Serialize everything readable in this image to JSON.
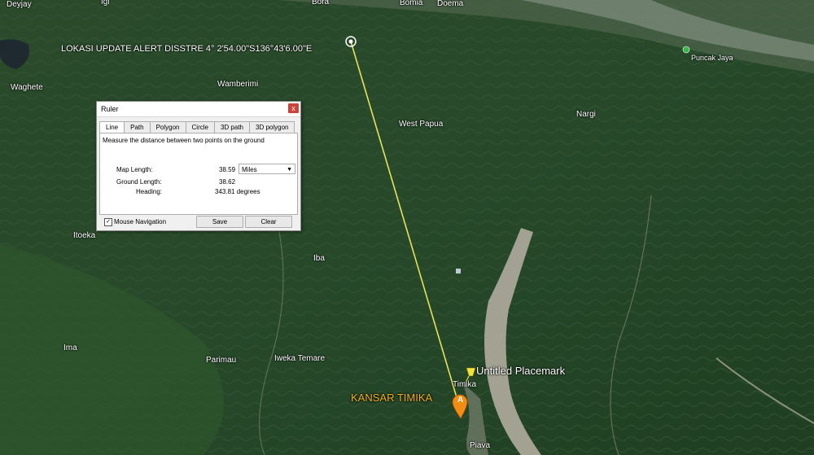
{
  "map": {
    "alert_text": "LOKASI UPDATE ALERT DISSTRE   4° 2'54.00\"S136°43'6.00\"E",
    "places": {
      "deyjay": "Deyjay",
      "bgi": "Igi",
      "bora": "Bora",
      "bomia": "Bomia",
      "doema": "Doema",
      "waghete": "Waghete",
      "wamberimi": "Wamberimi",
      "west_papua": "West Papua",
      "nargi": "Nargi",
      "puncak_jaya": "Puncak Jaya",
      "itoeka": "Itoeka",
      "iba": "Iba",
      "ima": "Ima",
      "parimau": "Parimau",
      "iweka_temare": "Iweka Temare",
      "timika": "Timika",
      "piava": "Piava"
    },
    "placemark_label": "Untitled Placemark",
    "kansar_label": "KANSAR TIMIKA",
    "pin_letter": "A",
    "line_color": "#e8e25a",
    "kansar_color": "#f2b21b",
    "pin_color": "#f28c12"
  },
  "ruler": {
    "title": "Ruler",
    "close": "x",
    "tabs": [
      "Line",
      "Path",
      "Polygon",
      "Circle",
      "3D path",
      "3D polygon"
    ],
    "description": "Measure the distance between two points on the ground",
    "map_length_label": "Map Length:",
    "map_length_value": "38.59",
    "unit": "Miles",
    "ground_length_label": "Ground Length:",
    "ground_length_value": "38.62",
    "heading_label": "Heading:",
    "heading_value": "343.81 degrees",
    "mouse_nav_label": "Mouse Navigation",
    "mouse_nav_checked": "✓",
    "save_label": "Save",
    "clear_label": "Clear"
  }
}
